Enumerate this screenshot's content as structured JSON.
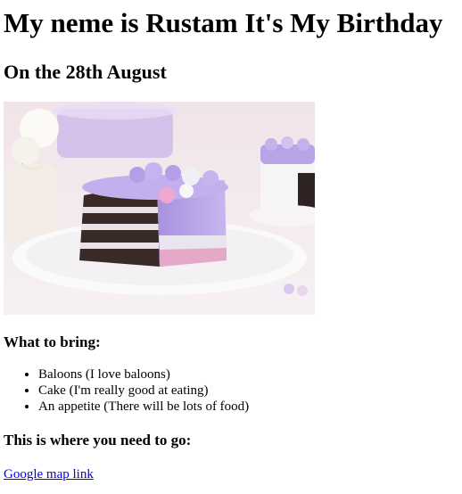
{
  "header": {
    "title": "My neme is Rustam It's My Birthday",
    "date_line": "On the 28th August"
  },
  "image": {
    "icon": "cake-slice-photo",
    "colors": {
      "background": "#f3e9ec",
      "frosting": "#b7a3e6",
      "sponge": "#3a2a27",
      "cream": "#e9e2e6",
      "pink_layer": "#e6a8c8",
      "plate": "#f7f4f6"
    }
  },
  "bring": {
    "heading": "What to bring:",
    "items": [
      "Baloons (I love baloons)",
      "Cake (I'm really good at eating)",
      "An appetite (There will be lots of food)"
    ]
  },
  "directions": {
    "heading": "This is where you need to go:",
    "link_text": "Google map link"
  }
}
